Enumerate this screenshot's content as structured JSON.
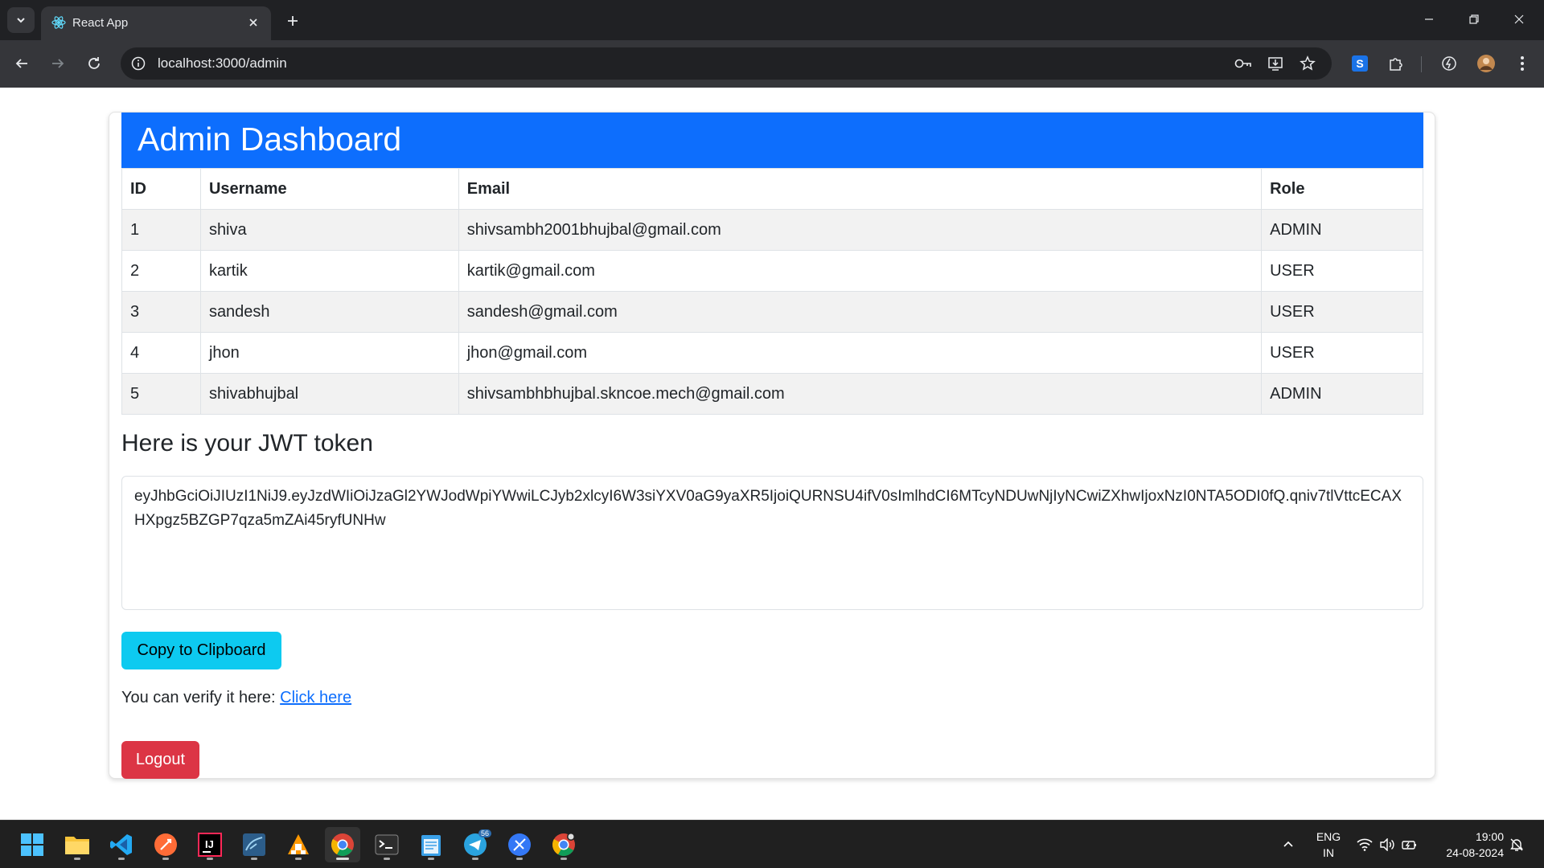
{
  "browser": {
    "tab_title": "React App",
    "url": "localhost:3000/admin"
  },
  "dashboard": {
    "title": "Admin Dashboard",
    "table": {
      "headers": [
        "ID",
        "Username",
        "Email",
        "Role"
      ],
      "rows": [
        [
          "1",
          "shiva",
          "shivsambh2001bhujbal@gmail.com",
          "ADMIN"
        ],
        [
          "2",
          "kartik",
          "kartik@gmail.com",
          "USER"
        ],
        [
          "3",
          "sandesh",
          "sandesh@gmail.com",
          "USER"
        ],
        [
          "4",
          "jhon",
          "jhon@gmail.com",
          "USER"
        ],
        [
          "5",
          "shivabhujbal",
          "shivsambhbhujbal.skncoe.mech@gmail.com",
          "ADMIN"
        ]
      ]
    },
    "jwt_heading": "Here is your JWT token",
    "jwt_token": "eyJhbGciOiJIUzI1NiJ9.eyJzdWIiOiJzaGl2YWJodWpiYWwiLCJyb2xlcyI6W3siYXV0aG9yaXR5IjoiQURNSU4ifV0sImlhdCI6MTcyNDUwNjIyNCwiZXhwIjoxNzI0NTA5ODI0fQ.qniv7tlVttcECAXHXpgz5BZGP7qza5mZAi45ryfUNHw",
    "copy_button": "Copy to Clipboard",
    "verify_text": "You can verify it here: ",
    "verify_link": "Click here",
    "logout_button": "Logout"
  },
  "taskbar": {
    "apps": [
      "start-icon",
      "file-explorer-icon",
      "vscode-icon",
      "postman-icon",
      "intellij-icon",
      "mysql-workbench-icon",
      "sublime-merge-icon",
      "chrome-icon",
      "terminal-icon",
      "notepad-icon",
      "telegram-icon",
      "browser-icon",
      "chrome-profile-icon"
    ],
    "telegram_badge": "56",
    "lang_line1": "ENG",
    "lang_line2": "IN",
    "time": "19:00",
    "date": "24-08-2024"
  },
  "colors": {
    "header": "#0d6efd",
    "copy_button": "#0dcaf0",
    "logout_button": "#dc3545",
    "link": "#0d6efd"
  }
}
